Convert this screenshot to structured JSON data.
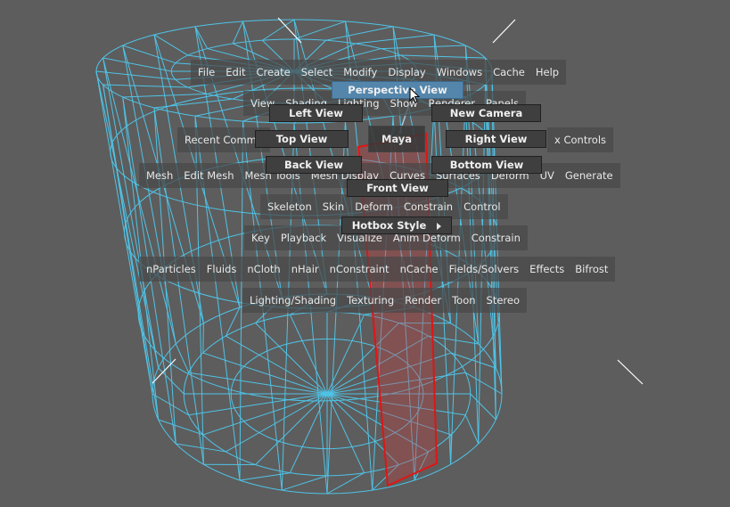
{
  "menubar": [
    "File",
    "Edit",
    "Create",
    "Select",
    "Modify",
    "Display",
    "Windows",
    "Cache",
    "Help"
  ],
  "panel_row": [
    "View",
    "Shading",
    "Lighting",
    "Show",
    "Renderer",
    "Panels"
  ],
  "recent_row_left": "Recent Comma",
  "recent_row_right": "x Controls",
  "center_label": "Maya",
  "modeling_row": [
    "Mesh",
    "Edit Mesh",
    "Mesh Tools",
    "Mesh Display",
    "Curves",
    "Surfaces",
    "Deform",
    "UV",
    "Generate"
  ],
  "rigging_row": [
    "Skeleton",
    "Skin",
    "Deform",
    "Constrain",
    "Control"
  ],
  "animation_row": [
    "Key",
    "Playback",
    "Visualize",
    "Anim Deform",
    "Constrain"
  ],
  "fx_row": [
    "nParticles",
    "Fluids",
    "nCloth",
    "nHair",
    "nConstraint",
    "nCache",
    "Fields/Solvers",
    "Effects",
    "Bifrost"
  ],
  "rendering_row": [
    "Lighting/Shading",
    "Texturing",
    "Render",
    "Toon",
    "Stereo"
  ],
  "marking_menu": {
    "north": "Perspective View",
    "north_west": "Left View",
    "north_east": "New Camera",
    "west": "Top View",
    "east": "Right View",
    "south_west": "Back View",
    "south_east": "Bottom View",
    "south": "Front View",
    "hotbox_style": "Hotbox Style"
  },
  "colors": {
    "background": "#5d5d5d",
    "wireframe": "#4fc3e6",
    "selected_face": "#d01818",
    "highlight": "#5486ac"
  }
}
